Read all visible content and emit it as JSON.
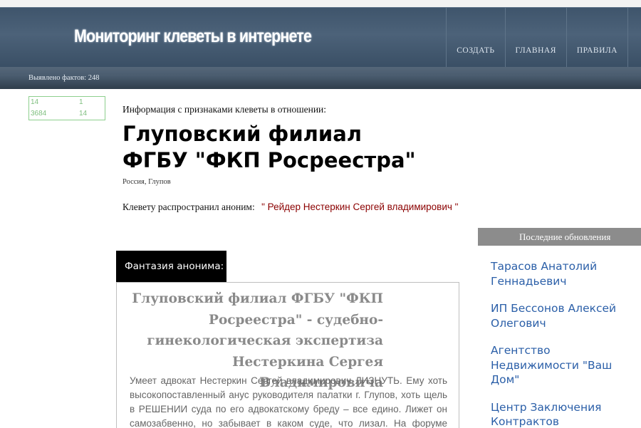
{
  "header": {
    "site_title": "Мониторинг клеветы в интернете",
    "nav": [
      "СОЗДАТЬ",
      "ГЛАВНАЯ",
      "ПРАВИЛА"
    ]
  },
  "subbar": {
    "facts_text": "Выявлено фактов: 248"
  },
  "counter": {
    "values": [
      "14",
      "1",
      "3684",
      "14"
    ]
  },
  "main": {
    "intro": "Информация с признаками клеветы в отношении:",
    "org_title_line1": "Глуповский филиал",
    "org_title_line2": "ФГБУ \"ФКП Росреестра\"",
    "location": "Россия, Глупов",
    "spread_label": "Клевету распространил аноним:",
    "spread_author": "\" Рейдер Нестеркин Сергей владимирович \"",
    "fantasy_tab": "Фантазия анонима:",
    "article_title": "Глуповский филиал ФГБУ \"ФКП Росреестра\" - судебно-гинекологическая экспертиза Нестеркина Сергея Владимировича",
    "article_body": "Умеет адвокат Нестеркин Сергей владимирович ЛИЗНУТЬ. Ему хоть высокопоставленный анус руководителя палатки г. Глупов, хоть щель в РЕШЕНИИ суда по его адвокатскому бреду – все едино. Лижет он самозабвенно, но забывает в каком суде, что лизал. На форуме «Сайт Рейдера Нестеркина» пишет, что в Росреестре"
  },
  "sidebar": {
    "updates_title": "Последние обновления",
    "updates": [
      "Тарасов Анатолий Геннадьевич",
      "ИП Бессонов Алексей Олегович",
      "Агентство Недвижимости \"Ваш Дом\"",
      "Центр Заключения Контрактов"
    ]
  }
}
